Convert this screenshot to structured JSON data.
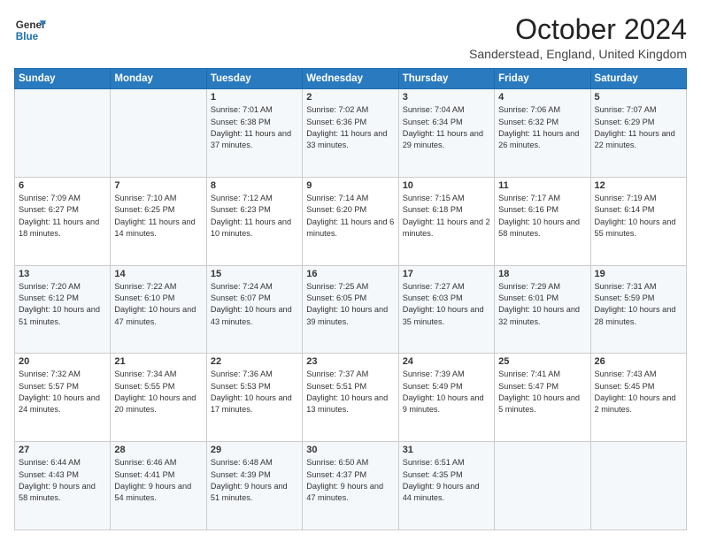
{
  "header": {
    "logo_line1": "General",
    "logo_line2": "Blue",
    "month": "October 2024",
    "location": "Sanderstead, England, United Kingdom"
  },
  "days_of_week": [
    "Sunday",
    "Monday",
    "Tuesday",
    "Wednesday",
    "Thursday",
    "Friday",
    "Saturday"
  ],
  "weeks": [
    [
      {
        "day": "",
        "info": ""
      },
      {
        "day": "",
        "info": ""
      },
      {
        "day": "1",
        "info": "Sunrise: 7:01 AM\nSunset: 6:38 PM\nDaylight: 11 hours and 37 minutes."
      },
      {
        "day": "2",
        "info": "Sunrise: 7:02 AM\nSunset: 6:36 PM\nDaylight: 11 hours and 33 minutes."
      },
      {
        "day": "3",
        "info": "Sunrise: 7:04 AM\nSunset: 6:34 PM\nDaylight: 11 hours and 29 minutes."
      },
      {
        "day": "4",
        "info": "Sunrise: 7:06 AM\nSunset: 6:32 PM\nDaylight: 11 hours and 26 minutes."
      },
      {
        "day": "5",
        "info": "Sunrise: 7:07 AM\nSunset: 6:29 PM\nDaylight: 11 hours and 22 minutes."
      }
    ],
    [
      {
        "day": "6",
        "info": "Sunrise: 7:09 AM\nSunset: 6:27 PM\nDaylight: 11 hours and 18 minutes."
      },
      {
        "day": "7",
        "info": "Sunrise: 7:10 AM\nSunset: 6:25 PM\nDaylight: 11 hours and 14 minutes."
      },
      {
        "day": "8",
        "info": "Sunrise: 7:12 AM\nSunset: 6:23 PM\nDaylight: 11 hours and 10 minutes."
      },
      {
        "day": "9",
        "info": "Sunrise: 7:14 AM\nSunset: 6:20 PM\nDaylight: 11 hours and 6 minutes."
      },
      {
        "day": "10",
        "info": "Sunrise: 7:15 AM\nSunset: 6:18 PM\nDaylight: 11 hours and 2 minutes."
      },
      {
        "day": "11",
        "info": "Sunrise: 7:17 AM\nSunset: 6:16 PM\nDaylight: 10 hours and 58 minutes."
      },
      {
        "day": "12",
        "info": "Sunrise: 7:19 AM\nSunset: 6:14 PM\nDaylight: 10 hours and 55 minutes."
      }
    ],
    [
      {
        "day": "13",
        "info": "Sunrise: 7:20 AM\nSunset: 6:12 PM\nDaylight: 10 hours and 51 minutes."
      },
      {
        "day": "14",
        "info": "Sunrise: 7:22 AM\nSunset: 6:10 PM\nDaylight: 10 hours and 47 minutes."
      },
      {
        "day": "15",
        "info": "Sunrise: 7:24 AM\nSunset: 6:07 PM\nDaylight: 10 hours and 43 minutes."
      },
      {
        "day": "16",
        "info": "Sunrise: 7:25 AM\nSunset: 6:05 PM\nDaylight: 10 hours and 39 minutes."
      },
      {
        "day": "17",
        "info": "Sunrise: 7:27 AM\nSunset: 6:03 PM\nDaylight: 10 hours and 35 minutes."
      },
      {
        "day": "18",
        "info": "Sunrise: 7:29 AM\nSunset: 6:01 PM\nDaylight: 10 hours and 32 minutes."
      },
      {
        "day": "19",
        "info": "Sunrise: 7:31 AM\nSunset: 5:59 PM\nDaylight: 10 hours and 28 minutes."
      }
    ],
    [
      {
        "day": "20",
        "info": "Sunrise: 7:32 AM\nSunset: 5:57 PM\nDaylight: 10 hours and 24 minutes."
      },
      {
        "day": "21",
        "info": "Sunrise: 7:34 AM\nSunset: 5:55 PM\nDaylight: 10 hours and 20 minutes."
      },
      {
        "day": "22",
        "info": "Sunrise: 7:36 AM\nSunset: 5:53 PM\nDaylight: 10 hours and 17 minutes."
      },
      {
        "day": "23",
        "info": "Sunrise: 7:37 AM\nSunset: 5:51 PM\nDaylight: 10 hours and 13 minutes."
      },
      {
        "day": "24",
        "info": "Sunrise: 7:39 AM\nSunset: 5:49 PM\nDaylight: 10 hours and 9 minutes."
      },
      {
        "day": "25",
        "info": "Sunrise: 7:41 AM\nSunset: 5:47 PM\nDaylight: 10 hours and 5 minutes."
      },
      {
        "day": "26",
        "info": "Sunrise: 7:43 AM\nSunset: 5:45 PM\nDaylight: 10 hours and 2 minutes."
      }
    ],
    [
      {
        "day": "27",
        "info": "Sunrise: 6:44 AM\nSunset: 4:43 PM\nDaylight: 9 hours and 58 minutes."
      },
      {
        "day": "28",
        "info": "Sunrise: 6:46 AM\nSunset: 4:41 PM\nDaylight: 9 hours and 54 minutes."
      },
      {
        "day": "29",
        "info": "Sunrise: 6:48 AM\nSunset: 4:39 PM\nDaylight: 9 hours and 51 minutes."
      },
      {
        "day": "30",
        "info": "Sunrise: 6:50 AM\nSunset: 4:37 PM\nDaylight: 9 hours and 47 minutes."
      },
      {
        "day": "31",
        "info": "Sunrise: 6:51 AM\nSunset: 4:35 PM\nDaylight: 9 hours and 44 minutes."
      },
      {
        "day": "",
        "info": ""
      },
      {
        "day": "",
        "info": ""
      }
    ]
  ]
}
